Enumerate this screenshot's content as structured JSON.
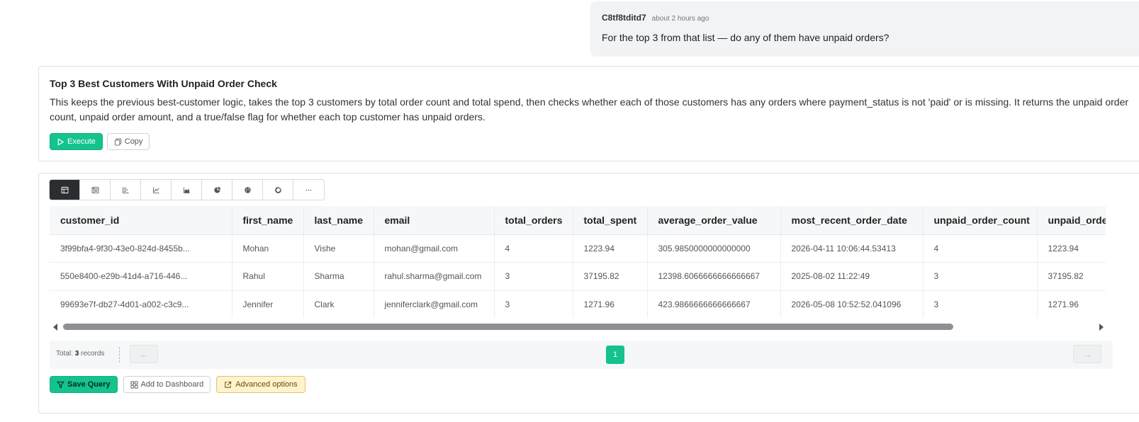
{
  "chat": {
    "user": "C8tf8tditd7",
    "time": "about 2 hours ago",
    "message": "For the top 3 from that list — do any of them have unpaid orders?"
  },
  "query": {
    "title": "Top 3 Best Customers With Unpaid Order Check",
    "description": "This keeps the previous best-customer logic, takes the top 3 customers by total order count and total spend, then checks whether each of those customers has any orders where payment_status is not 'paid' or is missing. It returns the unpaid order count, unpaid order amount, and a true/false flag for whether each top customer has unpaid orders.",
    "execute_label": "Execute",
    "copy_label": "Copy"
  },
  "views": [
    {
      "icon": "table-icon"
    },
    {
      "icon": "pivot-table-icon"
    },
    {
      "icon": "bar-chart-icon"
    },
    {
      "icon": "line-chart-icon"
    },
    {
      "icon": "area-chart-icon"
    },
    {
      "icon": "pie-chart-icon"
    },
    {
      "icon": "globe-icon"
    },
    {
      "icon": "donut-chart-icon"
    },
    {
      "icon": "more-icon"
    }
  ],
  "table": {
    "columns": [
      "customer_id",
      "first_name",
      "last_name",
      "email",
      "total_orders",
      "total_spent",
      "average_order_value",
      "most_recent_order_date",
      "unpaid_order_count",
      "unpaid_order_amount"
    ],
    "rows": [
      [
        "3f99bfa4-9f30-43e0-824d-8455b...",
        "Mohan",
        "Vishe",
        "mohan@gmail.com",
        "4",
        "1223.94",
        "305.9850000000000000",
        "2026-04-11 10:06:44.53413",
        "4",
        "1223.94"
      ],
      [
        "550e8400-e29b-41d4-a716-446...",
        "Rahul",
        "Sharma",
        "rahul.sharma@gmail.com",
        "3",
        "37195.82",
        "12398.6066666666666667",
        "2025-08-02 11:22:49",
        "3",
        "37195.82"
      ],
      [
        "99693e7f-db27-4d01-a002-c3c9...",
        "Jennifer",
        "Clark",
        "jenniferclark@gmail.com",
        "3",
        "1271.96",
        "423.9866666666666667",
        "2026-05-08 10:52:52.041096",
        "3",
        "1271.96"
      ]
    ]
  },
  "pager": {
    "total_prefix": "Total:",
    "total_count": "3",
    "total_suffix": "records",
    "prev": "←",
    "current_page": "1",
    "next": "→"
  },
  "actions": {
    "save_query": "Save Query",
    "add_to_dashboard": "Add to Dashboard",
    "advanced_options": "Advanced options"
  },
  "colors": {
    "accent": "#14c38e",
    "active_view": "#2b2d31",
    "advanced_bg": "#fdf3cf"
  }
}
